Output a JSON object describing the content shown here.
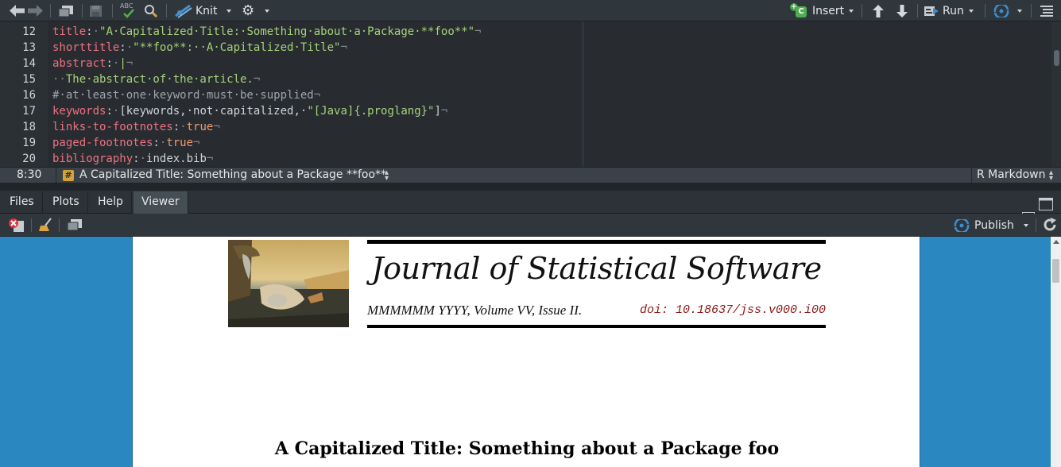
{
  "toolbar": {
    "knit_label": "Knit",
    "insert_label": "Insert",
    "insert_badge": "C",
    "run_label": "Run"
  },
  "editor": {
    "lines": [
      {
        "num": "12",
        "tokens": [
          {
            "t": "title",
            "c": "k"
          },
          {
            "t": ":",
            "c": "t"
          },
          {
            "t": "·",
            "c": "inv"
          },
          {
            "t": "\"A·Capitalized·Title:·Something·about·a·Package·**foo**\"",
            "c": "s"
          },
          {
            "t": "¬",
            "c": "inv"
          }
        ]
      },
      {
        "num": "13",
        "tokens": [
          {
            "t": "shorttitle",
            "c": "k"
          },
          {
            "t": ":",
            "c": "t"
          },
          {
            "t": "·",
            "c": "inv"
          },
          {
            "t": "\"**foo**:··A·Capitalized·Title\"",
            "c": "s"
          },
          {
            "t": "¬",
            "c": "inv"
          }
        ]
      },
      {
        "num": "14",
        "tokens": [
          {
            "t": "abstract",
            "c": "k"
          },
          {
            "t": ":",
            "c": "t"
          },
          {
            "t": "·",
            "c": "inv"
          },
          {
            "t": "|",
            "c": "s"
          },
          {
            "t": "¬",
            "c": "inv"
          }
        ]
      },
      {
        "num": "15",
        "tokens": [
          {
            "t": "··",
            "c": "inv"
          },
          {
            "t": "The·abstract·of·the·article.",
            "c": "s"
          },
          {
            "t": "¬",
            "c": "inv"
          }
        ]
      },
      {
        "num": "16",
        "tokens": [
          {
            "t": "#·at·least·one·keyword·must·be·supplied",
            "c": "c"
          },
          {
            "t": "¬",
            "c": "inv"
          }
        ]
      },
      {
        "num": "17",
        "tokens": [
          {
            "t": "keywords",
            "c": "k"
          },
          {
            "t": ":",
            "c": "t"
          },
          {
            "t": "·",
            "c": "inv"
          },
          {
            "t": "[keywords,·not·capitalized,·",
            "c": "t"
          },
          {
            "t": "\"[Java]{.proglang}\"",
            "c": "s"
          },
          {
            "t": "]",
            "c": "t"
          },
          {
            "t": "¬",
            "c": "inv"
          }
        ]
      },
      {
        "num": "18",
        "tokens": [
          {
            "t": "links-to-footnotes",
            "c": "k"
          },
          {
            "t": ":",
            "c": "t"
          },
          {
            "t": "·",
            "c": "inv"
          },
          {
            "t": "true",
            "c": "b"
          },
          {
            "t": "¬",
            "c": "inv"
          }
        ]
      },
      {
        "num": "19",
        "tokens": [
          {
            "t": "paged-footnotes",
            "c": "k"
          },
          {
            "t": ":",
            "c": "t"
          },
          {
            "t": "·",
            "c": "inv"
          },
          {
            "t": "true",
            "c": "b"
          },
          {
            "t": "¬",
            "c": "inv"
          }
        ]
      },
      {
        "num": "20",
        "tokens": [
          {
            "t": "bibliography",
            "c": "k"
          },
          {
            "t": ":",
            "c": "t"
          },
          {
            "t": "·",
            "c": "inv"
          },
          {
            "t": "index.bib",
            "c": "t"
          },
          {
            "t": "¬",
            "c": "inv"
          }
        ]
      }
    ]
  },
  "status": {
    "position": "8:30",
    "section_icon": "#",
    "section": "A Capitalized Title: Something about a Package **foo**",
    "mode": "R Markdown"
  },
  "pane": {
    "tabs": [
      "Files",
      "Plots",
      "Help",
      "Viewer"
    ],
    "active_tab": "Viewer",
    "publish_label": "Publish"
  },
  "viewer": {
    "journal_title": "Journal of Statistical Software",
    "journal_meta": "MMMMMM YYYY, Volume VV, Issue II.",
    "doi": "doi: 10.18637/jss.v000.i00",
    "paper_title": "A Capitalized Title: Something about a Package foo"
  },
  "colors": {
    "accent": "#2b87bf",
    "editor_bg": "#282c31",
    "keyword": "#ec7280",
    "string": "#a6d27a",
    "boolean": "#f09e6c",
    "doi": "#8c1515"
  }
}
